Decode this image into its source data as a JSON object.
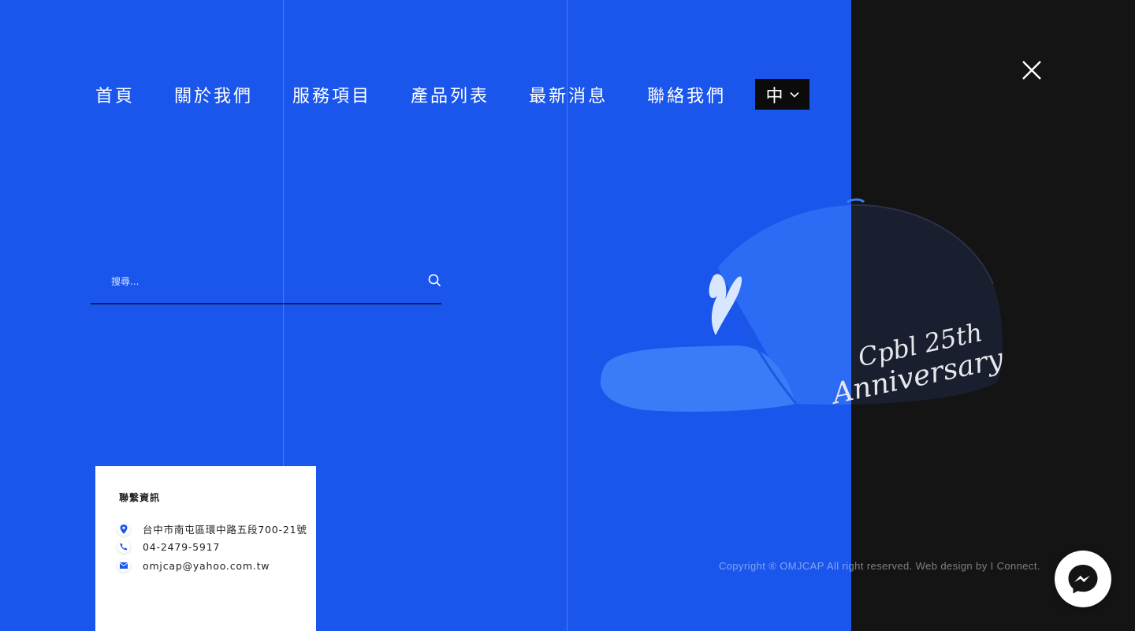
{
  "nav": {
    "items": [
      {
        "label": "首頁"
      },
      {
        "label": "關於我們"
      },
      {
        "label": "服務項目"
      },
      {
        "label": "產品列表"
      },
      {
        "label": "最新消息"
      },
      {
        "label": "聯絡我們"
      }
    ]
  },
  "language": {
    "label": "中",
    "icon": "chevron-down-icon"
  },
  "close": {
    "icon": "close-icon"
  },
  "search": {
    "placeholder": "搜尋...",
    "icon": "search-icon"
  },
  "hero": {
    "embroidery_line1": "Cpbl 25th",
    "embroidery_line2": "Anniversary"
  },
  "contact": {
    "title": "聯繫資訊",
    "address": "台中市南屯區環中路五段700-21號",
    "phone": "04-2479-5917",
    "email": "omjcap@yahoo.com.tw"
  },
  "footer": {
    "copyright": "Copyright ® OMJCAP All right reserved. Web design by I Connect."
  },
  "messenger": {
    "icon": "messenger-icon"
  },
  "colors": {
    "accent": "#1a56eb",
    "dark": "#141414",
    "card": "#ffffff"
  }
}
